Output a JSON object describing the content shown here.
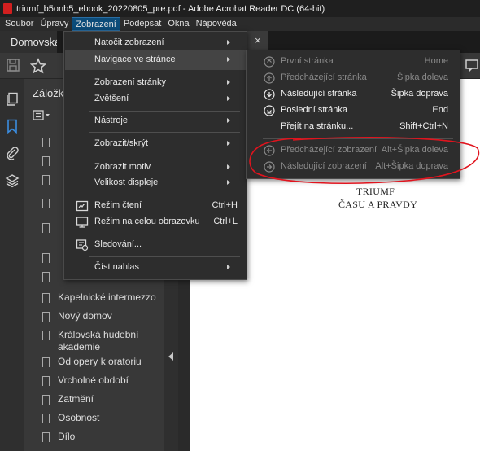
{
  "window": {
    "title": "triumf_b5onb5_ebook_20220805_pre.pdf - Adobe Acrobat Reader DC (64-bit)"
  },
  "menubar": {
    "items": [
      {
        "label": "Soubor",
        "active": false
      },
      {
        "label": "Úpravy",
        "active": false
      },
      {
        "label": "Zobrazení",
        "active": true
      },
      {
        "label": "Podepsat",
        "active": false
      },
      {
        "label": "Okna",
        "active": false
      },
      {
        "label": "Nápověda",
        "active": false
      }
    ]
  },
  "tabs": {
    "home": "Domovská s",
    "close_symbol": "×"
  },
  "toolbar": {
    "icons": [
      "save-icon",
      "star-icon",
      "comment-icon"
    ]
  },
  "left_rail": {
    "icons": [
      "pages-icon",
      "bookmark-icon",
      "attachment-icon",
      "layers-icon"
    ]
  },
  "bookmarks_panel": {
    "header": "Záložk",
    "items": [
      "Kapelnické intermezzo",
      "Nový domov",
      "Královská hudební akademie",
      "Od opery k oratoriu",
      "Vrcholné období",
      "Zatmění",
      "Osobnost",
      "Dílo"
    ]
  },
  "document": {
    "line1": "TRIUMF",
    "line2": "ČASU A PRAVDY"
  },
  "view_menu": {
    "items": [
      {
        "label": "Natočit zobrazení",
        "shortcut": "",
        "submenu": true,
        "icon": ""
      },
      {
        "label": "Navigace ve stránce",
        "shortcut": "",
        "submenu": true,
        "icon": "",
        "highlighted": true
      },
      {
        "label": "Zobrazení stránky",
        "shortcut": "",
        "submenu": true,
        "icon": ""
      },
      {
        "label": "Zvětšení",
        "shortcut": "",
        "submenu": true,
        "icon": ""
      },
      {
        "label": "Nástroje",
        "shortcut": "",
        "submenu": true,
        "icon": ""
      },
      {
        "label": "Zobrazit/skrýt",
        "shortcut": "",
        "submenu": true,
        "icon": ""
      },
      {
        "label": "Zobrazit motiv",
        "shortcut": "",
        "submenu": true,
        "icon": ""
      },
      {
        "label": "Velikost displeje",
        "shortcut": "",
        "submenu": true,
        "icon": ""
      },
      {
        "label": "Režim čtení",
        "shortcut": "Ctrl+H",
        "submenu": false,
        "icon": "reading-mode-icon"
      },
      {
        "label": "Režim na celou obrazovku",
        "shortcut": "Ctrl+L",
        "submenu": false,
        "icon": "fullscreen-icon"
      },
      {
        "label": "Sledování...",
        "shortcut": "",
        "submenu": false,
        "icon": "tracking-icon"
      },
      {
        "label": "Číst nahlas",
        "shortcut": "",
        "submenu": true,
        "icon": ""
      }
    ]
  },
  "navigation_submenu": {
    "items": [
      {
        "label": "První stránka",
        "shortcut": "Home",
        "enabled": false,
        "icon": "first-page-icon"
      },
      {
        "label": "Předcházející stránka",
        "shortcut": "Šipka doleva",
        "enabled": false,
        "icon": "previous-page-icon"
      },
      {
        "label": "Následující stránka",
        "shortcut": "Šipka doprava",
        "enabled": true,
        "icon": "next-page-icon"
      },
      {
        "label": "Poslední stránka",
        "shortcut": "End",
        "enabled": true,
        "icon": "last-page-icon"
      },
      {
        "label": "Přejít na stránku...",
        "shortcut": "Shift+Ctrl+N",
        "enabled": true,
        "icon": ""
      },
      {
        "label": "Předcházející zobrazení",
        "shortcut": "Alt+Šipka doleva",
        "enabled": false,
        "icon": "previous-view-icon"
      },
      {
        "label": "Následující zobrazení",
        "shortcut": "Alt+Šipka doprava",
        "enabled": false,
        "icon": "next-view-icon"
      }
    ]
  },
  "colors": {
    "annotation": "#e0141e",
    "menu_highlight": "#444444",
    "menubar_active": "#0c4c7a"
  }
}
